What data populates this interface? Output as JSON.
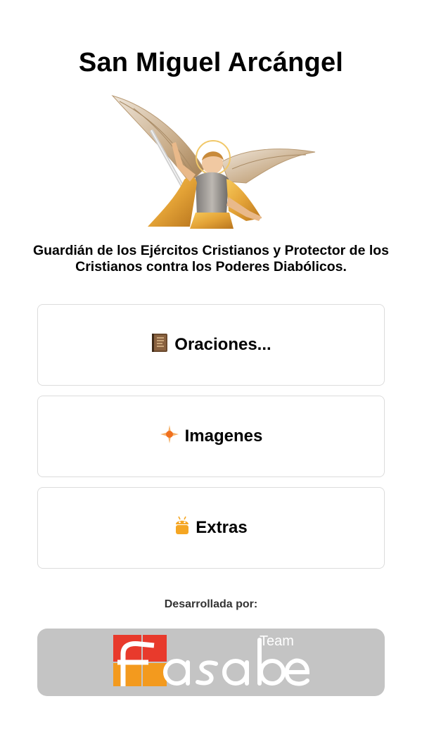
{
  "header": {
    "title": "San Miguel Arcángel"
  },
  "image": {
    "alt": "San Miguel Arcángel"
  },
  "subtitle": "Guardián de los Ejércitos Cristianos y Protector de los Cristianos contra los Poderes Diabólicos.",
  "menu": [
    {
      "label": "Oraciones...",
      "icon": "book-icon"
    },
    {
      "label": "Imagenes",
      "icon": "sparkle-icon"
    },
    {
      "label": "Extras",
      "icon": "android-icon"
    }
  ],
  "footer": {
    "developed_by": "Desarrollada por:",
    "brand_main": "Fasabe",
    "brand_team": "Team"
  },
  "colors": {
    "brand_red": "#e83a2c",
    "brand_orange": "#f39a1e",
    "brand_bar": "#c4c4c4",
    "button_border": "#dcdcdc",
    "icon_orange": "#f5a623"
  }
}
